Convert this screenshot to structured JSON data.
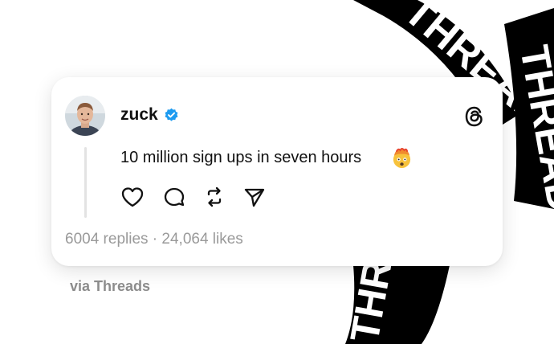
{
  "post": {
    "username": "zuck",
    "text": "10 million sign ups in seven hours",
    "emoji": "exploding-head-emoji",
    "stats": "6004 replies · 24,064 likes"
  },
  "footer": {
    "via": "via Threads"
  },
  "background": {
    "ring_text_top": "THREADS",
    "ring_text_right": "THREADS",
    "ring_text_bottom": "THREADS"
  },
  "icons": {
    "verified": "verified-badge-icon",
    "brand": "threads-logo-icon",
    "like": "heart-icon",
    "reply": "comment-icon",
    "repost": "repost-icon",
    "share": "send-icon"
  },
  "colors": {
    "verified_blue": "#1d9bf0",
    "ring_black": "#000000",
    "stats_gray": "#9a9a9a"
  }
}
